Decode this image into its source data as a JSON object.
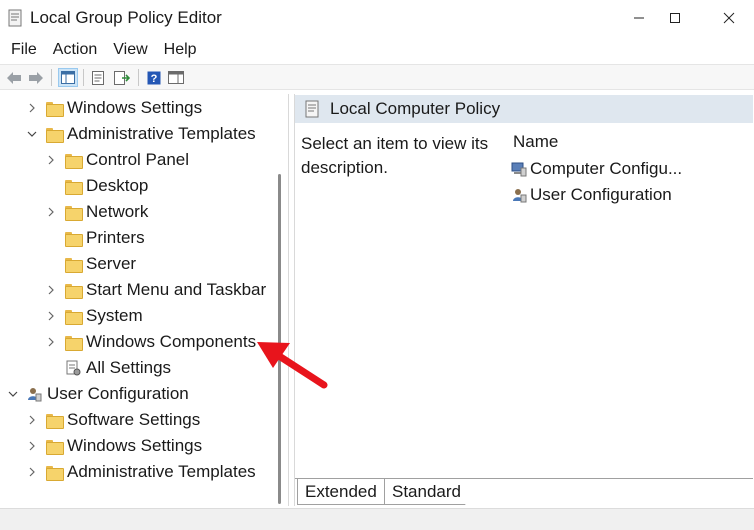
{
  "window": {
    "title": "Local Group Policy Editor"
  },
  "menu": [
    "File",
    "Action",
    "View",
    "Help"
  ],
  "tree": {
    "items": [
      {
        "label": "Windows Settings",
        "level": 1,
        "expander": "collapsed",
        "icon": "folder-icon"
      },
      {
        "label": "Administrative Templates",
        "level": 1,
        "expander": "expanded",
        "icon": "folder-icon"
      },
      {
        "label": "Control Panel",
        "level": 2,
        "expander": "collapsed",
        "icon": "folder-icon"
      },
      {
        "label": "Desktop",
        "level": 2,
        "expander": "none",
        "icon": "folder-icon"
      },
      {
        "label": "Network",
        "level": 2,
        "expander": "collapsed",
        "icon": "folder-icon"
      },
      {
        "label": "Printers",
        "level": 2,
        "expander": "none",
        "icon": "folder-icon"
      },
      {
        "label": "Server",
        "level": 2,
        "expander": "none",
        "icon": "folder-icon"
      },
      {
        "label": "Start Menu and Taskbar",
        "level": 2,
        "expander": "collapsed",
        "icon": "folder-icon"
      },
      {
        "label": "System",
        "level": 2,
        "expander": "collapsed",
        "icon": "folder-icon"
      },
      {
        "label": "Windows Components",
        "level": 2,
        "expander": "collapsed",
        "icon": "folder-icon"
      },
      {
        "label": "All Settings",
        "level": 2,
        "expander": "none",
        "icon": "settings-list-icon"
      },
      {
        "label": "User Configuration",
        "level": 0,
        "expander": "expanded",
        "icon": "user-config-icon"
      },
      {
        "label": "Software Settings",
        "level": 1,
        "expander": "collapsed",
        "icon": "folder-icon"
      },
      {
        "label": "Windows Settings",
        "level": 1,
        "expander": "collapsed",
        "icon": "folder-icon"
      },
      {
        "label": "Administrative Templates",
        "level": 1,
        "expander": "collapsed",
        "icon": "folder-icon"
      }
    ]
  },
  "right_pane": {
    "header": "Local Computer Policy",
    "description": "Select an item to view its description.",
    "column_name": "Name",
    "items": [
      {
        "label": "Computer Configu...",
        "icon": "computer-config-icon"
      },
      {
        "label": "User Configuration",
        "icon": "user-config-icon"
      }
    ],
    "tabs": [
      "Extended",
      "Standard"
    ],
    "active_tab": "Extended"
  },
  "colors": {
    "header_bg": "#dfe7ef",
    "folder": "#f6d36b",
    "annotation_arrow": "#e8141c"
  }
}
